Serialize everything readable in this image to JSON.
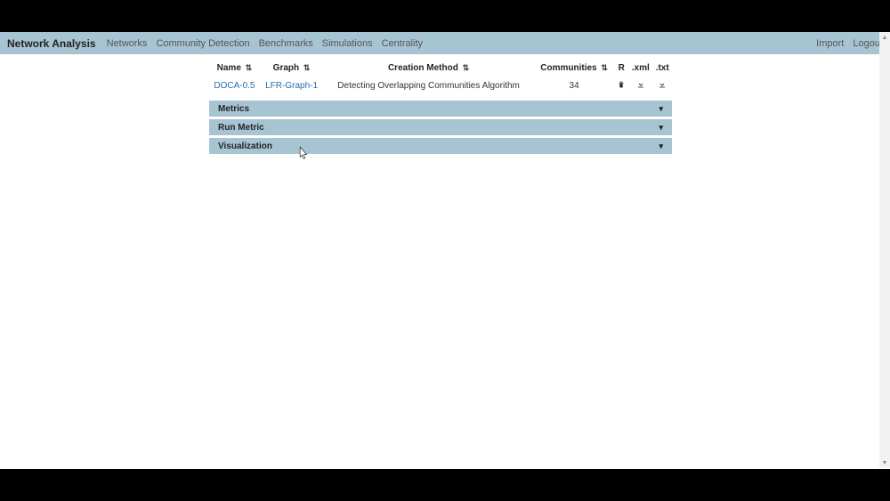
{
  "navbar": {
    "brand": "Network Analysis",
    "items": [
      "Networks",
      "Community Detection",
      "Benchmarks",
      "Simulations",
      "Centrality"
    ],
    "right_items": [
      "Import",
      "Logout"
    ]
  },
  "table": {
    "headers": {
      "name": "Name",
      "graph": "Graph",
      "creation_method": "Creation Method",
      "communities": "Communities",
      "r": "R",
      "xml": ".xml",
      "txt": ".txt"
    },
    "rows": [
      {
        "name": "DOCA-0.5",
        "graph": "LFR-Graph-1",
        "creation_method": "Detecting Overlapping Communities Algorithm",
        "communities": "34"
      }
    ]
  },
  "accordions": [
    {
      "label": "Metrics"
    },
    {
      "label": "Run Metric"
    },
    {
      "label": "Visualization"
    }
  ]
}
